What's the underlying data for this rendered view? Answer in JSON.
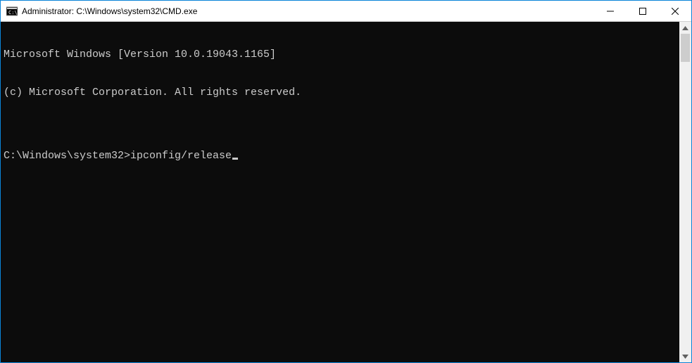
{
  "titlebar": {
    "title": "Administrator: C:\\Windows\\system32\\CMD.exe"
  },
  "terminal": {
    "lines": [
      "Microsoft Windows [Version 10.0.19043.1165]",
      "(c) Microsoft Corporation. All rights reserved.",
      ""
    ],
    "prompt": "C:\\Windows\\system32>",
    "command": "ipconfig/release"
  }
}
